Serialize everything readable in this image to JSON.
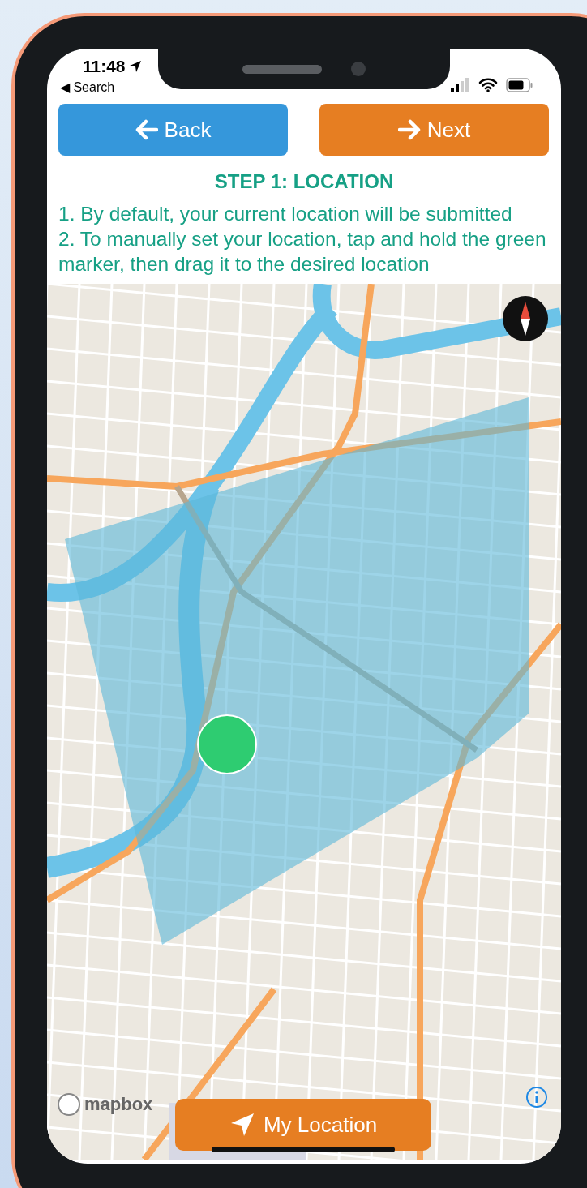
{
  "status_bar": {
    "time": "11:48",
    "back_label": "◀ Search"
  },
  "nav_buttons": [
    {
      "kind": "back",
      "label": "Back"
    },
    {
      "kind": "next",
      "label": "Next"
    }
  ],
  "step_title": "STEP 1: LOCATION",
  "instructions": [
    "1. By default, your current location will be submitted",
    "2. To manually set your location, tap and hold the green marker, then drag it to the desired location"
  ],
  "map": {
    "attribution": "mapbox",
    "my_location_button": "My Location"
  }
}
